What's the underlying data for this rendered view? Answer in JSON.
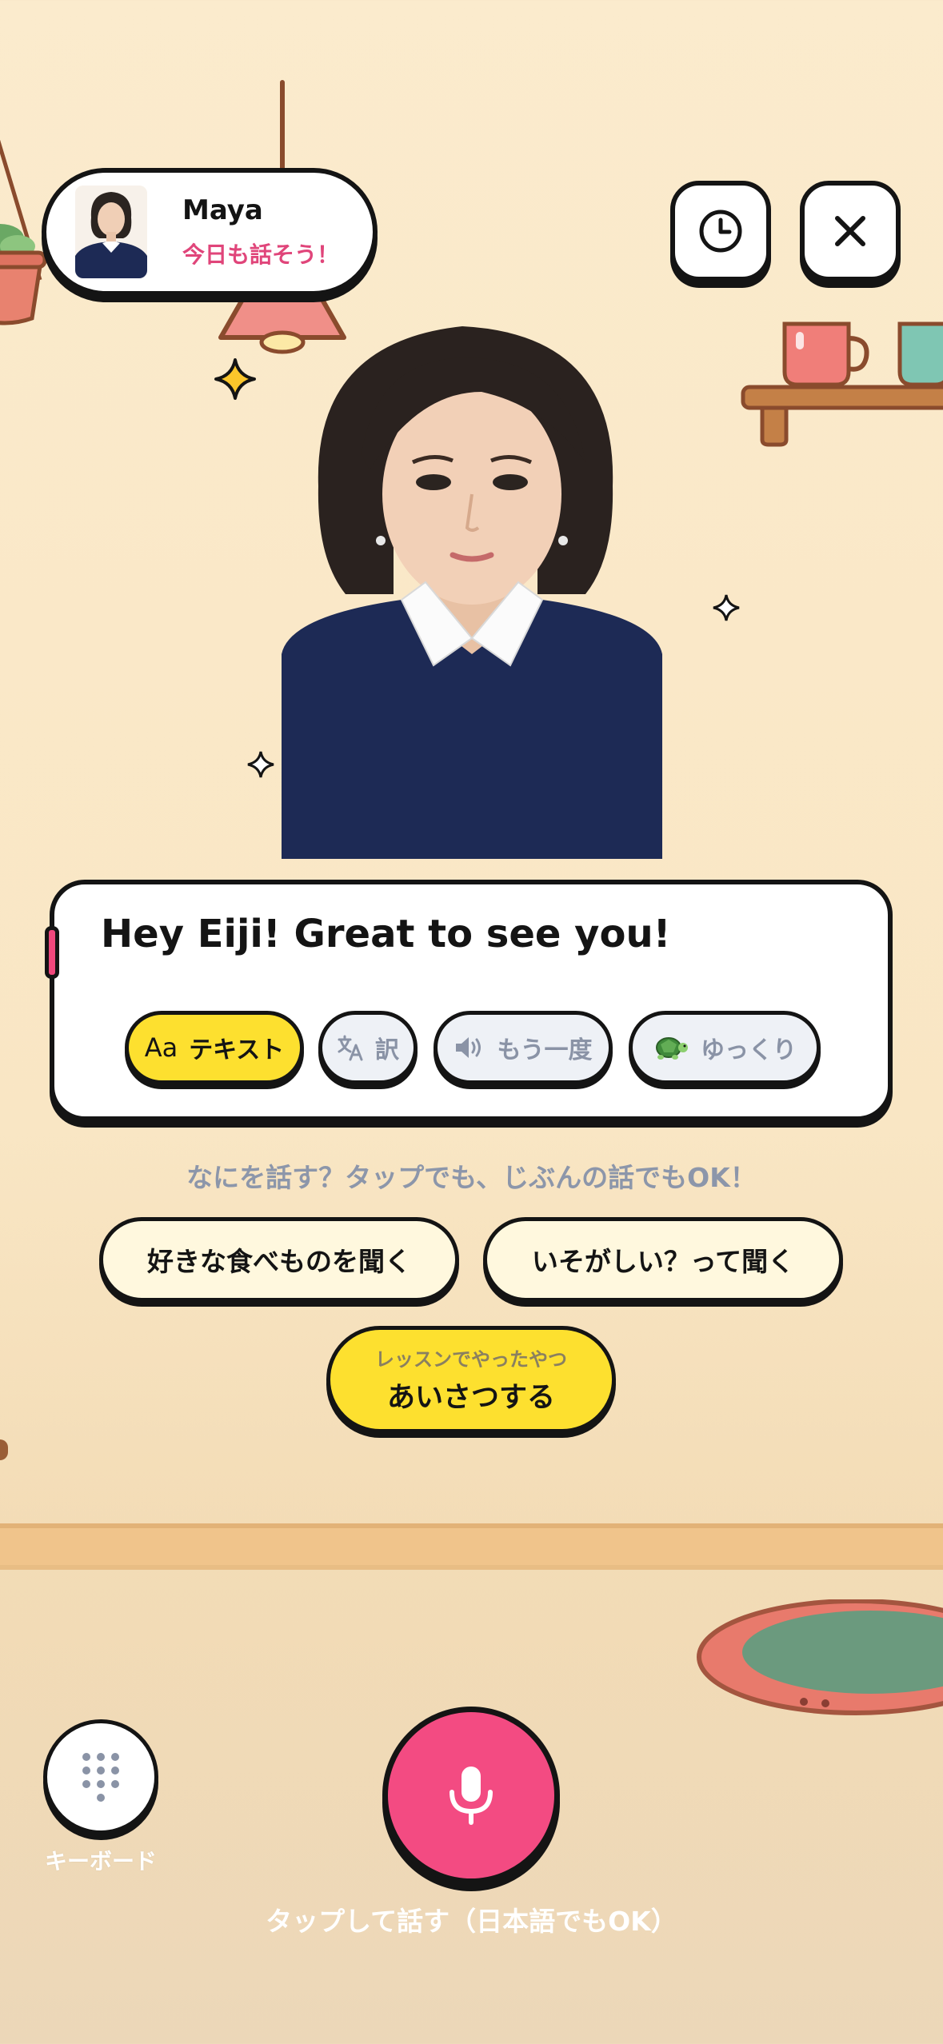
{
  "profile": {
    "name": "Maya",
    "subtitle": "今日も話そう！"
  },
  "header": {
    "history_icon": "clock-icon",
    "close_icon": "close-icon"
  },
  "message": {
    "text": "Hey Eiji! Great to see you!"
  },
  "actions": {
    "text_icon": "Aa",
    "text_label": "テキスト",
    "translate_icon": "translate-icon",
    "translate_label": "訳",
    "repeat_icon": "speaker-icon",
    "repeat_label": "もう一度",
    "slow_icon": "🐢",
    "slow_label": "ゆっくり"
  },
  "suggestions": {
    "hint": "なにを話す？タップでも、じぶんの話でもOK！",
    "items": [
      {
        "label": "好きな食べものを聞く"
      },
      {
        "label": "いそがしい？って聞く"
      },
      {
        "sub": "レッスンでやったやつ",
        "label": "あいさつする"
      }
    ]
  },
  "controls": {
    "keyboard_label": "キーボード",
    "mic_label": "タップして話す（日本語でもOK）"
  },
  "colors": {
    "accent_pink": "#f34b82",
    "accent_yellow": "#fde02f",
    "outline": "#141414",
    "hint_gray": "#8c96aa"
  }
}
